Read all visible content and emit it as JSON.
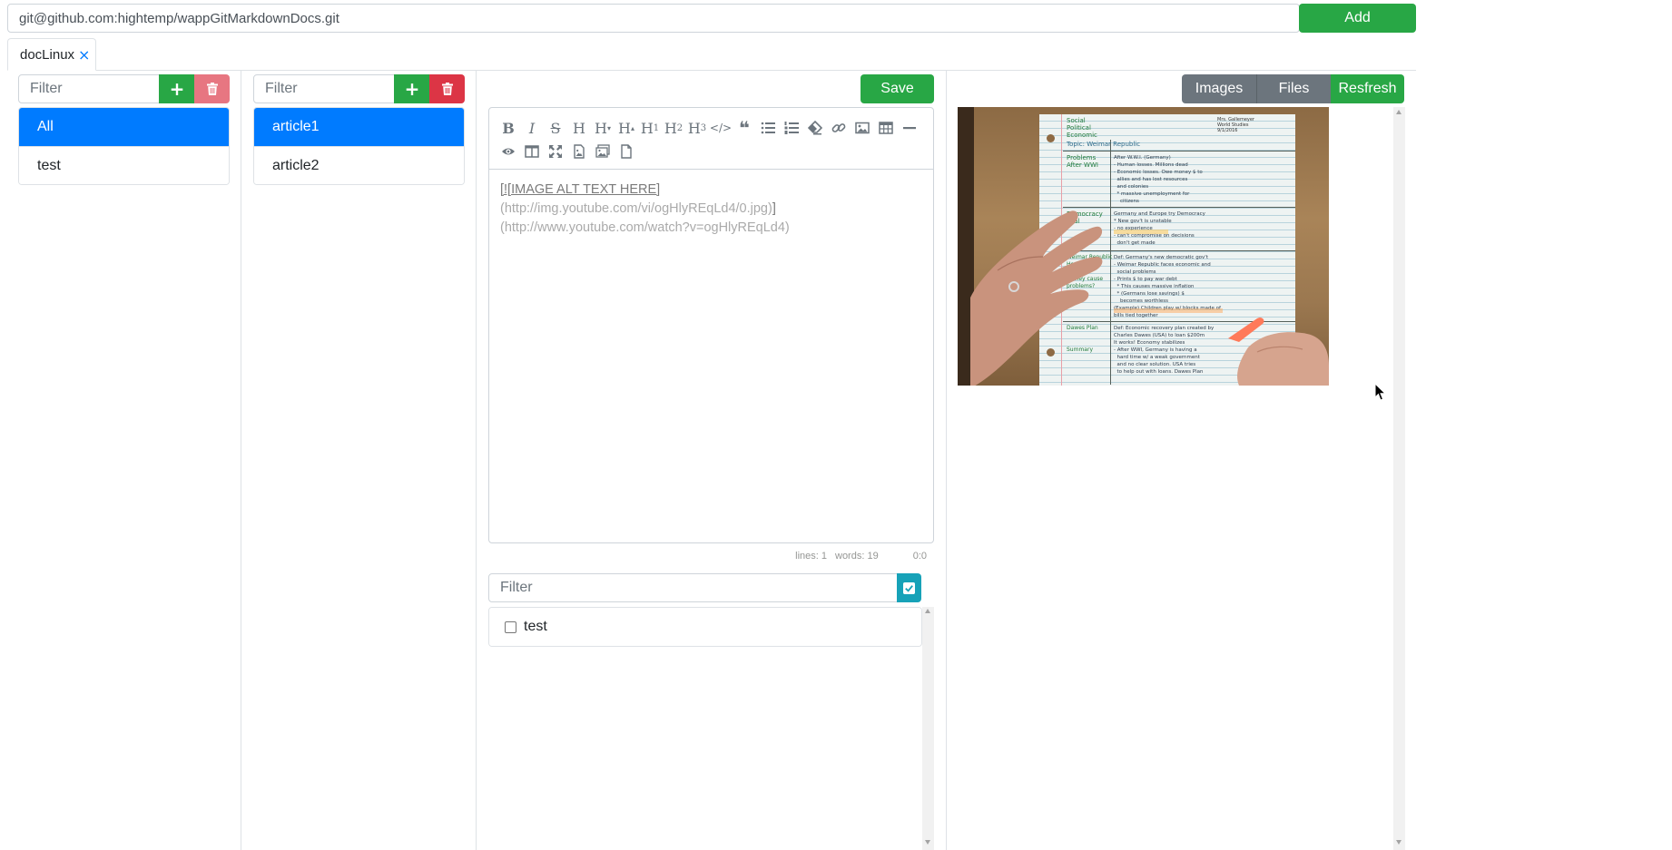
{
  "repo": {
    "url_value": "git@github.com:hightemp/wappGitMarkdownDocs.git",
    "add_label": "Add"
  },
  "tabs": [
    {
      "label": "docLinux",
      "close": "×"
    }
  ],
  "categories": {
    "filter_placeholder": "Filter",
    "add_icon": "+",
    "items": [
      {
        "label": "All",
        "active": true
      },
      {
        "label": "test",
        "active": false
      }
    ]
  },
  "articles": {
    "filter_placeholder": "Filter",
    "add_icon": "+",
    "items": [
      {
        "label": "article1",
        "active": true
      },
      {
        "label": "article2",
        "active": false
      }
    ]
  },
  "editor": {
    "save_label": "Save",
    "content_link_text": "[![IMAGE ALT TEXT HERE]",
    "content_url1": "(http://img.youtube.com/vi/ogHlyREqLd4/0.jpg)",
    "content_bracket": "]",
    "content_url2": "(http://www.youtube.com/watch?v=ogHlyREqLd4)",
    "status_lines": "lines: 1",
    "status_words": "words: 19",
    "status_cursor": "0:0",
    "toolbar_icons": [
      "bold-icon",
      "italic-icon",
      "strikethrough-icon",
      "heading-icon",
      "heading-smaller-icon",
      "heading-bigger-icon",
      "heading-1-icon",
      "heading-2-icon",
      "heading-3-icon",
      "code-icon",
      "quote-icon",
      "unordered-list-icon",
      "ordered-list-icon",
      "clean-block-icon",
      "link-icon",
      "image-icon",
      "table-icon",
      "horizontal-rule-icon",
      "preview-icon",
      "side-by-side-icon",
      "fullscreen-icon",
      "upload-image-icon",
      "insert-image-icon",
      "file-icon"
    ]
  },
  "tags": {
    "filter_placeholder": "Filter",
    "items": [
      {
        "label": "test",
        "checked": false
      }
    ]
  },
  "preview": {
    "images_label": "Images",
    "files_label": "Files",
    "refresh_label": "Resfresh",
    "image_alt": "IMAGE ALT TEXT HERE",
    "notebook_text": {
      "header_left": "Social\nPolitical\nEconomic",
      "header_right": "Mrs. Gallemeyer\nWorld Studies\n9/1/2016",
      "topic": "Topic: Weimar Republic",
      "rows": [
        {
          "left": "Problems\nAfter WWI",
          "right": "After W.W.I. (Germany)\n- Human losses. Millions dead\n- Economic losses. Owe money $ to\n  allies and has lost resources\n  and colonies\n  * massive unemployment for\n    citizens"
        },
        {
          "left": "Democracy\nTrial",
          "right": "Germany and Europe try Democracy\n* New gov't is unstable\n- no experience\n- can't compromise on decisions\n  don't get made"
        },
        {
          "left": "Weimar Republic\nHow does\nprinting\nmoney cause\nproblems?",
          "right": "Def: Germany's new democratic gov't\n- Weimar Republic faces economic and\n  social problems\n- Prints $ to pay war debt\n  * This causes massive inflation\n  * (Germans lose savings) $\n    becomes worthless\n(Example) Children play w/ blocks made of\nbills tied together"
        },
        {
          "left": "Dawes Plan",
          "right": "Def: Economic recovery plan created by\nCharles Dawes (USA) to loan $200m\nIt works! Economy stabilizes\n- After WWI, Germany is having a\n  hard time w/ a weak government\n  and no clear solution. USA tries\n  to help out with loans. Dawes Plan"
        },
        {
          "left": "Summary",
          "right": ""
        }
      ]
    }
  },
  "colors": {
    "primary": "#007bff",
    "success": "#28a745",
    "danger": "#dc3545",
    "secondary": "#6c757d",
    "info": "#17a2b8"
  }
}
